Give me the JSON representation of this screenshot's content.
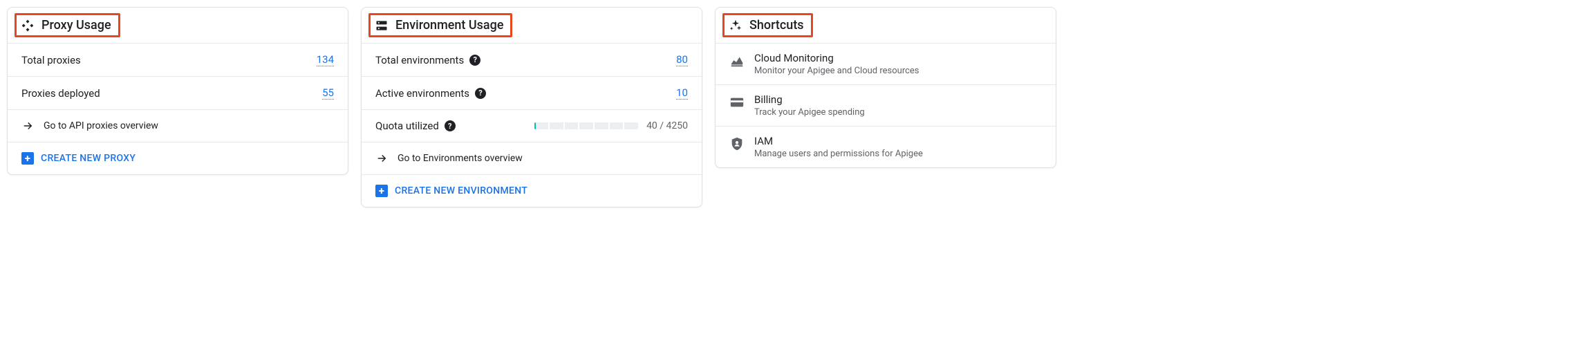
{
  "proxy": {
    "title": "Proxy Usage",
    "rows": {
      "total_label": "Total proxies",
      "total_value": "134",
      "deployed_label": "Proxies deployed",
      "deployed_value": "55"
    },
    "overview_link": "Go to API proxies overview",
    "create_label": "CREATE NEW PROXY"
  },
  "env": {
    "title": "Environment Usage",
    "rows": {
      "total_label": "Total environments",
      "total_value": "80",
      "active_label": "Active environments",
      "active_value": "10",
      "quota_label": "Quota utilized",
      "quota_text": "40 / 4250"
    },
    "overview_link": "Go to Environments overview",
    "create_label": "CREATE NEW ENVIRONMENT"
  },
  "shortcuts": {
    "title": "Shortcuts",
    "items": [
      {
        "title": "Cloud Monitoring",
        "desc": "Monitor your Apigee and Cloud resources"
      },
      {
        "title": "Billing",
        "desc": "Track your Apigee spending"
      },
      {
        "title": "IAM",
        "desc": "Manage users and permissions for Apigee"
      }
    ]
  }
}
